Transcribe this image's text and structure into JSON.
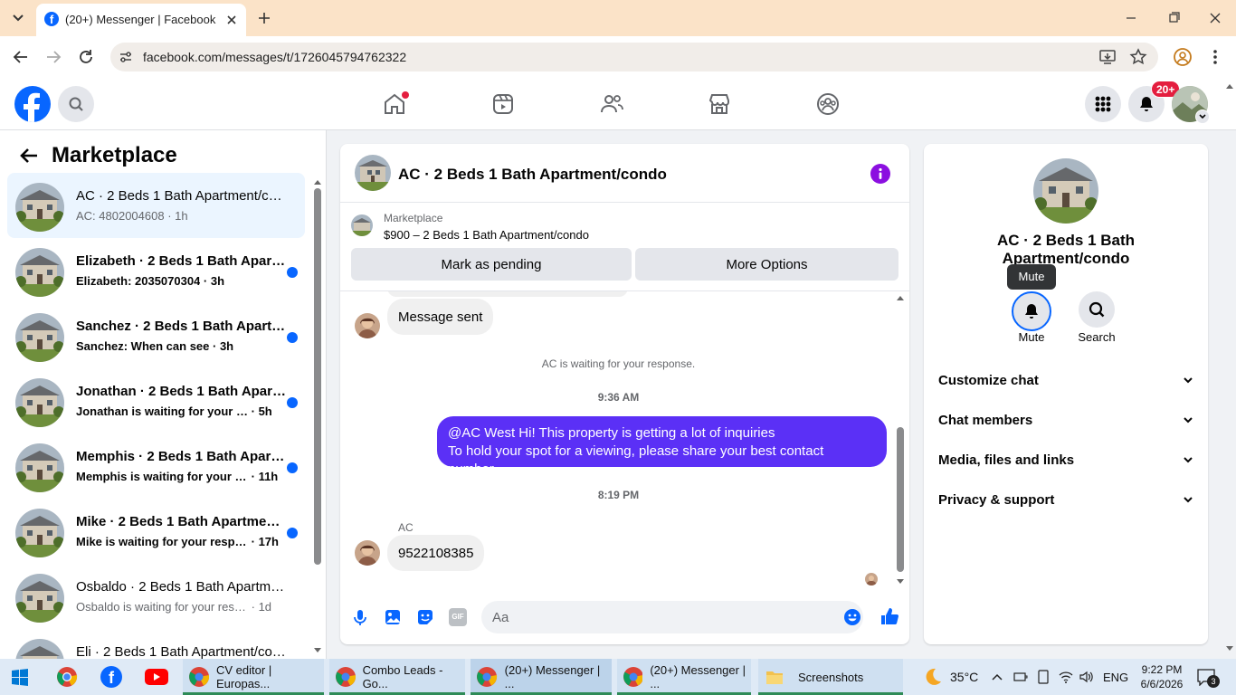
{
  "browser": {
    "tab_title": "(20+) Messenger | Facebook",
    "url": "facebook.com/messages/t/1726045794762322"
  },
  "fb_header": {
    "notification_badge": "20+"
  },
  "left": {
    "title": "Marketplace",
    "conversations": [
      {
        "title": "AC · 2 Beds 1 Bath Apartment/condo",
        "preview": "AC: 4802004608",
        "time": "1h"
      },
      {
        "title": "Elizabeth · 2 Beds 1 Bath Apartment/condo",
        "preview": "Elizabeth: 2035070304",
        "time": "3h"
      },
      {
        "title": "Sanchez · 2 Beds 1 Bath Apartment/condo",
        "preview": "Sanchez: When can see",
        "time": "3h"
      },
      {
        "title": "Jonathan · 2 Beds 1 Bath Apartment/condo",
        "preview": "Jonathan is waiting for your response.",
        "time": "5h"
      },
      {
        "title": "Memphis · 2 Beds 1 Bath Apartment/condo",
        "preview": "Memphis is waiting for your response.",
        "time": "11h"
      },
      {
        "title": "Mike · 2 Beds 1 Bath Apartment/condo",
        "preview": "Mike is waiting for your response.",
        "time": "17h"
      },
      {
        "title": "Osbaldo · 2 Beds 1 Bath Apartment/condo",
        "preview": "Osbaldo is waiting for your response.",
        "time": "1d"
      },
      {
        "title": "Eli · 2 Beds 1 Bath Apartment/condo",
        "preview": "",
        "time": ""
      }
    ]
  },
  "chat": {
    "title": "AC · 2 Beds 1 Bath Apartment/condo",
    "listing_label": "Marketplace",
    "listing_text": "$900 – 2 Beds 1 Bath Apartment/condo",
    "mark_pending": "Mark as pending",
    "more_options": "More Options",
    "msg_sent": "Message sent",
    "waiting": "AC is waiting for your response.",
    "time1": "9:36 AM",
    "outgoing_line1": "@AC West Hi! This property is getting a lot of inquiries",
    "outgoing_line2": "To hold your spot for a viewing, please share your best contact number.",
    "time2": "8:19 PM",
    "sender": "AC",
    "incoming": "9522108385",
    "input_placeholder": "Aa",
    "gif_label": "GIF"
  },
  "right": {
    "title": "AC · 2 Beds 1 Bath Apartment/condo",
    "tooltip": "Mute",
    "mute_label": "Mute",
    "search_label": "Search",
    "sections": [
      "Customize chat",
      "Chat members",
      "Media, files and links",
      "Privacy & support"
    ]
  },
  "taskbar": {
    "apps": [
      {
        "label": "CV editor | Europas..."
      },
      {
        "label": "Combo Leads - Go..."
      },
      {
        "label": "(20+) Messenger | ..."
      },
      {
        "label": "(20+) Messenger | ..."
      },
      {
        "label": "Screenshots"
      }
    ],
    "temperature": "35°C",
    "language": "ENG",
    "time": "9:22 PM",
    "date": "6/6/2026",
    "notif_count": "3"
  },
  "colors": {
    "accent": "#0866ff",
    "outgoing": "#5b30f6",
    "unread_dot": "#0866ff",
    "badge": "#e41e3f"
  }
}
